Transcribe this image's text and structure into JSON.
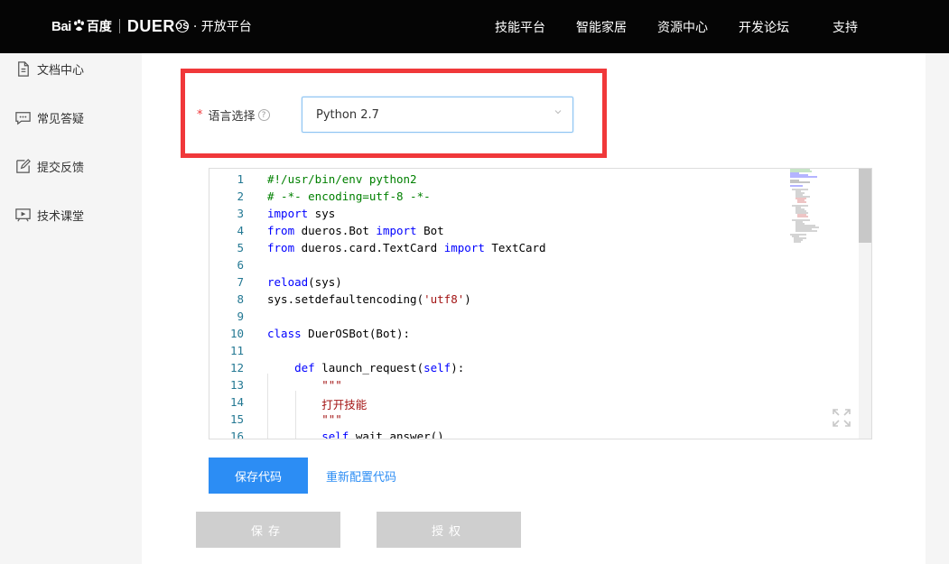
{
  "header": {
    "logo_baidu": "Bai",
    "logo_baidu_cn": "百度",
    "logo_dueros": "DUER",
    "logo_dueros_os": "OS",
    "logo_platform": "· 开放平台",
    "nav": [
      "技能平台",
      "智能家居",
      "资源中心",
      "开发论坛",
      "支持"
    ]
  },
  "sidebar": {
    "items": [
      {
        "label": "文档中心",
        "icon": "document-icon"
      },
      {
        "label": "常见答疑",
        "icon": "chat-icon"
      },
      {
        "label": "提交反馈",
        "icon": "edit-icon"
      },
      {
        "label": "技术课堂",
        "icon": "video-icon"
      }
    ]
  },
  "form": {
    "required_mark": "*",
    "language_label": "语言选择",
    "help_glyph": "?",
    "language_value": "Python 2.7"
  },
  "editor": {
    "lines": [
      {
        "n": "1",
        "html": "<span class=\"c-comment\">#!/usr/bin/env python2</span>"
      },
      {
        "n": "2",
        "html": "<span class=\"c-comment\"># -*- encoding=utf-8 -*-</span>"
      },
      {
        "n": "3",
        "html": "<span class=\"c-kw\">import</span> sys"
      },
      {
        "n": "4",
        "html": "<span class=\"c-kw\">from</span> dueros.Bot <span class=\"c-kw\">import</span> Bot"
      },
      {
        "n": "5",
        "html": "<span class=\"c-kw\">from</span> dueros.card.TextCard <span class=\"c-kw\">import</span> TextCard"
      },
      {
        "n": "6",
        "html": ""
      },
      {
        "n": "7",
        "html": "<span class=\"c-kw\">reload</span>(sys)"
      },
      {
        "n": "8",
        "html": "sys.setdefaultencoding(<span class=\"c-str\">'utf8'</span>)"
      },
      {
        "n": "9",
        "html": ""
      },
      {
        "n": "10",
        "html": "<span class=\"c-kw\">class</span> DuerOSBot(Bot):"
      },
      {
        "n": "11",
        "html": ""
      },
      {
        "n": "12",
        "html": "    <span class=\"c-kw\">def</span> launch_request(<span class=\"c-self\">self</span>):"
      },
      {
        "n": "13",
        "html": "        <span class=\"c-str\">\"\"\"</span>"
      },
      {
        "n": "14",
        "html": "        <span class=\"c-str\">打开技能</span>"
      },
      {
        "n": "15",
        "html": "        <span class=\"c-str\">\"\"\"</span>"
      },
      {
        "n": "16",
        "html": "        <span class=\"c-self\">self</span>.wait_answer()"
      }
    ]
  },
  "actions": {
    "save_code": "保存代码",
    "reset_code": "重新配置代码",
    "save": "保存",
    "authorize": "授权"
  },
  "colors": {
    "accent": "#2c8df4",
    "highlight": "#f0383a",
    "topbar": "#050505"
  }
}
